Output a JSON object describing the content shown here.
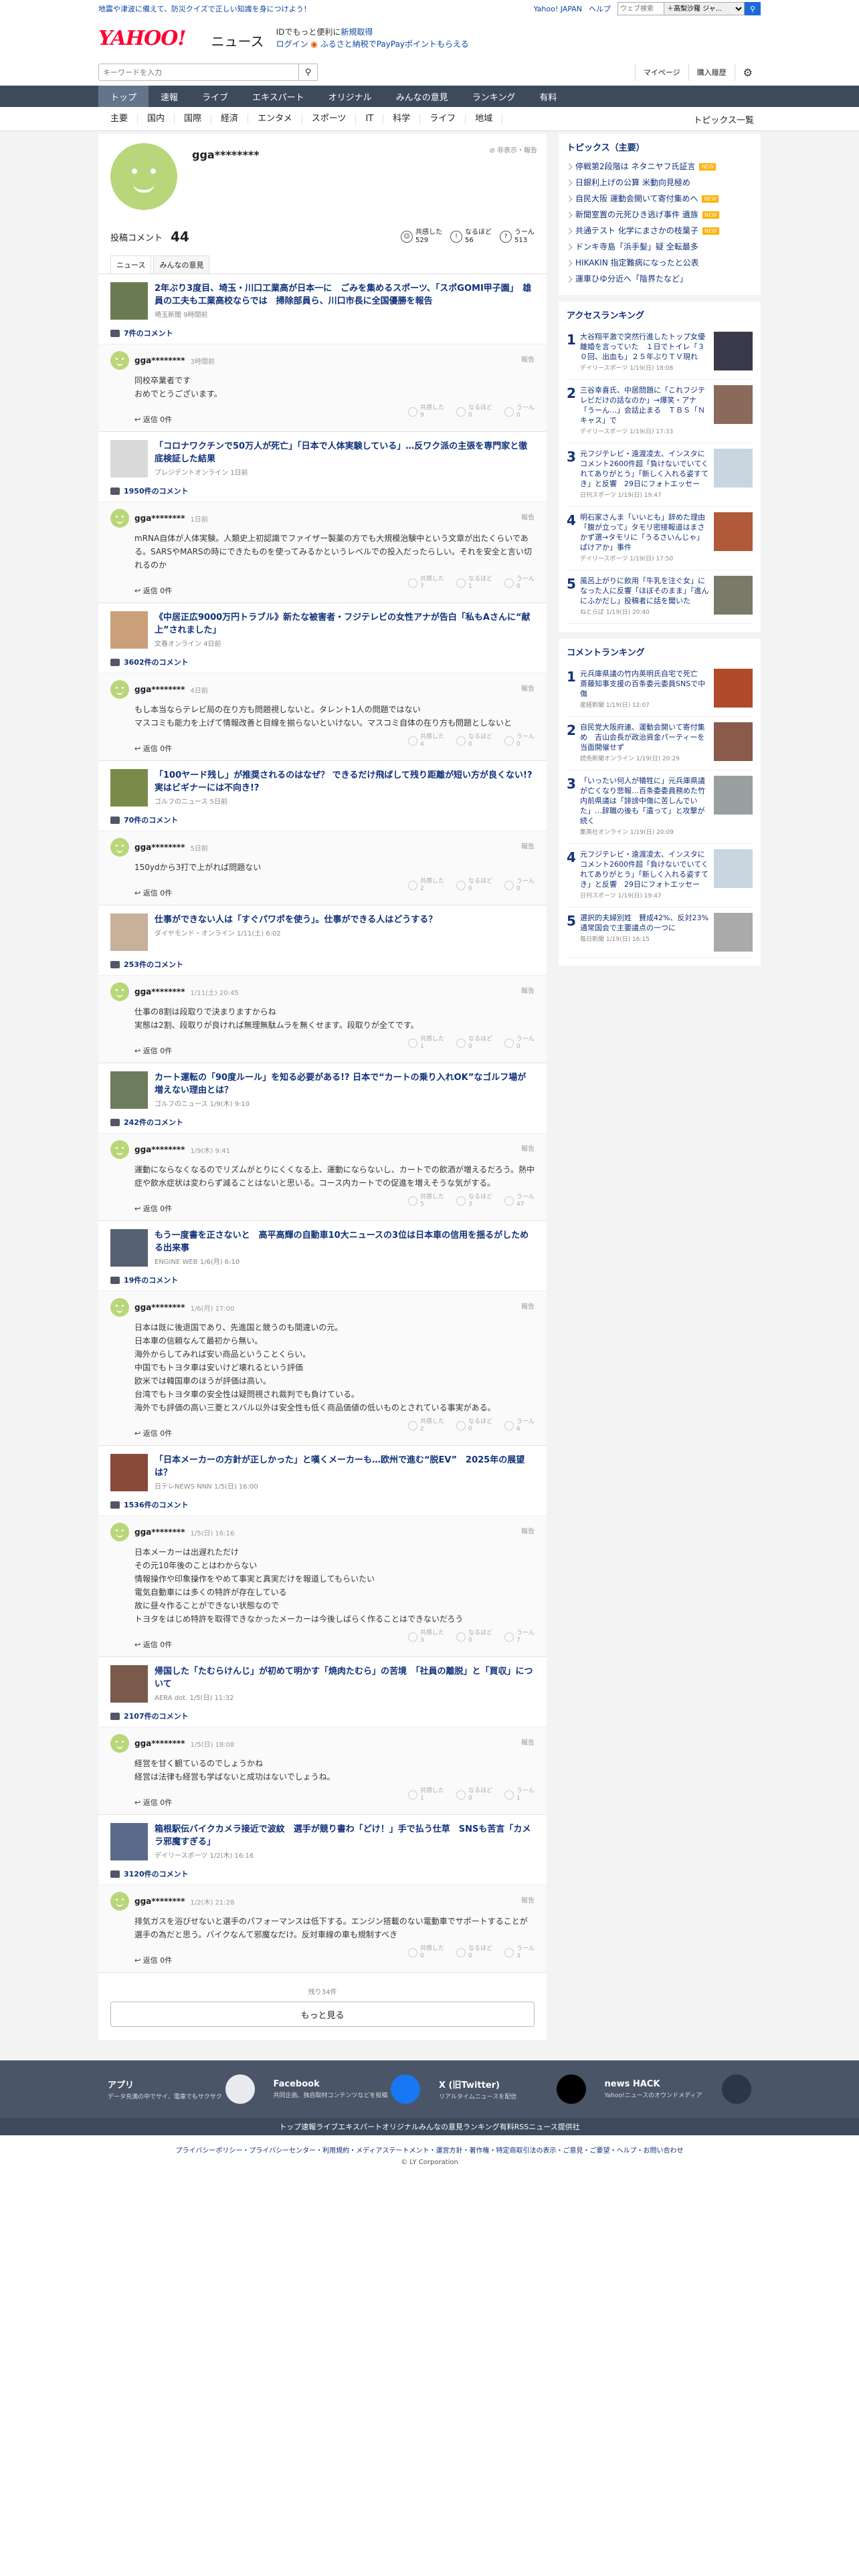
{
  "topstrip": {
    "promo": "地震や津波に備えて、防災クイズで正しい知識を身につけよう！",
    "yahoo": "Yahoo! JAPAN",
    "help": "ヘルプ",
    "search_placeholder": "ウェブ検索",
    "select": "＋高梨沙羅 ジャ..."
  },
  "header": {
    "logo": "YAHOO!",
    "logo_sub": "JAPAN",
    "service": "ニュース",
    "login_l1": "IDでもっと便利に",
    "login_l1_link": "新規取得",
    "login_link": "ログイン",
    "login_l2": "ふるさと納税でPayPayポイントもらえる"
  },
  "search": {
    "placeholder": "キーワードを入力",
    "mypage": "マイページ",
    "purchase": "購入履歴"
  },
  "tabs": [
    "トップ",
    "速報",
    "ライブ",
    "エキスパート",
    "オリジナル",
    "みんなの意見",
    "ランキング",
    "有料"
  ],
  "cats": [
    "主要",
    "国内",
    "国際",
    "経済",
    "エンタメ",
    "スポーツ",
    "IT",
    "科学",
    "ライフ",
    "地域"
  ],
  "cats_all": "トピックス一覧",
  "profile": {
    "name": "gga********",
    "report": "非表示・報告",
    "comments_label": "投稿コメント",
    "comments_count": "44",
    "rx1_label": "共感した",
    "rx1": "529",
    "rx2_label": "なるほど",
    "rx2": "56",
    "rx3_label": "うーん",
    "rx3": "513",
    "tab1": "ニュース",
    "tab2": "みんなの意見"
  },
  "entries": [
    {
      "title": "2年ぶり3度目、埼玉・川口工業高が日本一に　ごみを集めるスポーツ、「スポGOMI甲子園」　雄員の工夫も工業高校ならでは　掃除部員ら、川口市長に全国優勝を報告",
      "src": "埼玉新聞 9時間前",
      "count": "7件のコメント",
      "name": "gga********",
      "date": "3時間前",
      "body": [
        "同校卒業者です",
        "おめでとうございます。"
      ],
      "r1": "9",
      "r2": "0",
      "r3": "0"
    },
    {
      "title": "「コロナワクチンで50万人が死亡」「日本で人体実験している」…反ワク派の主張を専門家と徹底検証した結果",
      "src": "プレジデントオンライン 1日前",
      "count": "1950件のコメント",
      "name": "gga********",
      "date": "1日前",
      "body": [
        "mRNA自体が人体実験。人類史上初認識でファイザー製薬の方でも大規模治験中という文章が出たくらいである。SARSやMARSの時にできたものを使ってみるかというレベルでの投入だったらしい。それを安全と言い切れるのか"
      ],
      "r1": "7",
      "r2": "1",
      "r3": "0"
    },
    {
      "title": "《中居正広9000万円トラブル》新たな被害者・フジテレビの女性アナが告白「私もAさんに“献上”されました」",
      "src": "文春オンライン 4日前",
      "count": "3602件のコメント",
      "name": "gga********",
      "date": "4日前",
      "body": [
        "もし本当ならテレビ局の在り方も問題視しないと。タレント1人の問題ではない",
        "マスコミも能力を上げて情報改善と目線を揃らないといけない。マスコミ自体の在り方も問題としないと"
      ],
      "r1": "4",
      "r2": "0",
      "r3": "0"
    },
    {
      "title": "「100ヤード残し」が推奨されるのはなぜ？ できるだけ飛ばして残り距離が短い方が良くない!? 実はビギナーには不向き!?",
      "src": "ゴルフのニュース 5日前",
      "count": "70件のコメント",
      "name": "gga********",
      "date": "5日前",
      "body": [
        "150ydから3打で上がれば問題ない"
      ],
      "r1": "2",
      "r2": "0",
      "r3": "0"
    },
    {
      "title": "仕事ができない人は「すぐパワポを使う」。仕事ができる人はどうする？",
      "src": "ダイヤモンド・オンライン 1/11(土) 6:02",
      "count": "253件のコメント",
      "name": "gga********",
      "date": "1/11(土) 20:45",
      "body": [
        "仕事の8割は段取りで決まりますからね",
        "実態は2割、段取りが良ければ無理無駄ムラを無くせます。段取りが全てです。"
      ],
      "r1": "1",
      "r2": "0",
      "r3": "0"
    },
    {
      "title": "カート運転の「90度ルール」を知る必要がある!? 日本で“カートの乗り入れOK”なゴルフ場が増えない理由とは？",
      "src": "ゴルフのニュース 1/9(木) 9:10",
      "count": "242件のコメント",
      "name": "gga********",
      "date": "1/9(木) 9:41",
      "body": [
        "運動にならなくなるのでリズムがとりにくくなる上、運動にならないし、カートでの飲酒が増えるだろう。熱中症や飲水症状は変わらず減ることはないと思いる。コース内カートでの促進を増えそうな気がする。"
      ],
      "r1": "5",
      "r2": "3",
      "r3": "47"
    },
    {
      "title": "もう一度書を正さないと　高平高輝の自動車10大ニュースの3位は日本車の信用を揺るがしためる出来事",
      "src": "ENGINE WEB 1/6(月) 6:10",
      "count": "19件のコメント",
      "name": "gga********",
      "date": "1/6(月) 17:00",
      "body": [
        "日本は既に後退国であり、先進国と競うのも間違いの元。",
        "日本車の信頼なんて最初から無い。",
        "海外からしてみれば安い商品ということくらい。",
        "中国でもトヨタ車は安いけど壊れるという評価",
        "欧米では韓国車のほうが評価は高い。",
        "台湾でもトヨタ車の安全性は疑問視され裁判でも負けている。",
        "海外でも評価の高い三菱とスバル以外は安全性も低く商品価値の低いものとされている事実がある。"
      ],
      "r1": "2",
      "r2": "0",
      "r3": "6"
    },
    {
      "title": "「日本メーカーの方針が正しかった」と嘆くメーカーも…欧州で進む“脱EV”　2025年の展望は？",
      "src": "日テレNEWS NNN 1/5(日) 16:00",
      "count": "1536件のコメント",
      "name": "gga********",
      "date": "1/5(日) 16:16",
      "body": [
        "日本メーカーは出遅れただけ",
        "その元10年後のことはわからない",
        "情報操作や印象操作をやめて事実と真実だけを報道してもらいたい",
        "電気自動車には多くの特許が存在している",
        "故に昼々作ることができない状態なので",
        "トヨタをはじめ特許を取得できなかったメーカーは今後しばらく作ることはできないだろう"
      ],
      "r1": "3",
      "r2": "0",
      "r3": "7"
    },
    {
      "title": "帰国した「たむらけんじ」が初めて明かす「焼肉たむら」の苦境　「社員の離脱」と「買収」について",
      "src": "AERA dot. 1/5(日) 11:32",
      "count": "2107件のコメント",
      "name": "gga********",
      "date": "1/5(日) 18:08",
      "body": [
        "経営を甘く観ているのでしょうかね",
        "経営は法律も経営も学ばないと成功はないでしょうね。"
      ],
      "r1": "1",
      "r2": "0",
      "r3": "1"
    },
    {
      "title": "箱根駅伝バイクカメラ接近で波紋　選手が競り書わ「どけ！」手で払う仕草　SNSも苦言「カメラ邪魔すぎる」",
      "src": "デイリースポーツ 1/2(木) 16:16",
      "count": "3120件のコメント",
      "name": "gga********",
      "date": "1/2(木) 21:28",
      "body": [
        "排気ガスを浴びせないと選手のパフォーマンスは低下する。エンジン搭載のない電動車でサポートすることが選手の為だと思う。バイクなんて邪魔なだけ。反対車線の車も規制すべき"
      ],
      "r1": "0",
      "r2": "0",
      "r3": "3"
    }
  ],
  "rx_labels": {
    "a": "共感した",
    "b": "なるほど",
    "c": "うーん"
  },
  "reply_label": "返信 0件",
  "more": {
    "remaining": "残り34件",
    "button": "もっと見る"
  },
  "side": {
    "topics_title": "トピックス（主要）",
    "topics": [
      {
        "t": "停戦第2段階は ネタニヤフ氏証言",
        "new": "NEW"
      },
      {
        "t": "日銀利上げの公算 米動向見極め",
        "new": ""
      },
      {
        "t": "自民大阪 運動会開いて寄付集めへ",
        "new": "NEW"
      },
      {
        "t": "新聞室置の元死ひき逃げ事件 遺族",
        "new": "NEW"
      },
      {
        "t": "共通テスト 化学にまさかの枝葉子",
        "new": "NEW"
      },
      {
        "t": "ドンキ寺島「浜手髪」疑 全転最多",
        "new": ""
      },
      {
        "t": "HIKAKIN 指定難病になったと公表",
        "new": ""
      },
      {
        "t": "運車ひゆ分近へ「陰界たなど」",
        "new": ""
      }
    ],
    "access_title": "アクセスランキング",
    "access": [
      {
        "n": "1",
        "t": "大谷翔平激で突然行進したトップ女優　離婚を言っていた　１日でトイレ「３０回、出血も」２５年ぶりＴＶ現れ",
        "s": "デイリースポーツ 1/19(日) 18:08"
      },
      {
        "n": "2",
        "t": "三谷幸喜氏、中居問題に「これフジテレビだけの話なのか」→爆笑・アナ「うーん…」会話止まる　ＴＢＳ「Ｎキャス」で",
        "s": "デイリースポーツ 1/19(日) 17:33"
      },
      {
        "n": "3",
        "t": "元フジテレビ・遠渡凌太、インスタにコメント2600件超「負けないでいてくれてありがとう」「新しく入れる姿すてき」と反響　29日にフォトエッセー",
        "s": "日刊スポーツ 1/19(日) 19:47"
      },
      {
        "n": "4",
        "t": "明石家さんま「いいとも」辞めた理由「腹が立って」タモリ密接報道はまさかず選→タモリに「うるさいんじゃ」ぱけアか」事件",
        "s": "デイリースポーツ 1/19(日) 17:50"
      },
      {
        "n": "5",
        "t": "風呂上がりに飲用「牛乳を注ぐ女」になった人に反響「ほぼそのまま」「進んにふかだし」投稿者に話を聞いた",
        "s": "ねとらぼ 1/19(日) 20:40"
      }
    ],
    "comment_title": "コメントランキング",
    "comment": [
      {
        "n": "1",
        "t": "元兵庫県議の竹内英明氏自宅で死亡　斎藤知事支援の百条委元委員SNSで中傷",
        "s": "産経新聞 1/19(日) 12:07"
      },
      {
        "n": "2",
        "t": "自民党大阪府連、運動会開いて寄付集め　吉山会長が政治資金パーティーを当面開催せず",
        "s": "読売新聞オンライン 1/19(日) 20:29"
      },
      {
        "n": "3",
        "t": "「いったい何人が犠牲に」元兵庫県議が亡くなり悲報…百条委委員務めた竹内前県議は「誹謗中傷に苦しんでいた」…辞職の後も「遺って」と攻撃が続く",
        "s": "集英社オンライン 1/19(日) 20:09"
      },
      {
        "n": "4",
        "t": "元フジテレビ・遠渡凌太、インスタにコメント2600件超「負けないでいてくれてありがとう」「新しく入れる姿すてき」と反響　29日にフォトエッセー",
        "s": "日刊スポーツ 1/19(日) 19:47"
      },
      {
        "n": "5",
        "t": "選択的夫婦別姓　賛成42%、反対23%　通常国会で主要議点の一つに",
        "s": "毎日新聞 1/19(日) 16:15"
      }
    ]
  },
  "footer": {
    "apps": [
      {
        "t": "アプリ",
        "d": "データ充満の中でサイ、電車でもサクサク"
      },
      {
        "t": "Facebook",
        "d": "共同企画、独自取材コンテンツなどを投稿"
      },
      {
        "t": "X (旧Twitter)",
        "d": "リアルタイムニュースを配信"
      },
      {
        "t": "news HACK",
        "d": "Yahoo!ニュースのオウンドメディア"
      }
    ],
    "nav": [
      "トップ",
      "速報",
      "ライブ",
      "エキスパート",
      "オリジナル",
      "みんなの意見",
      "ランキング",
      "有料",
      "RSS",
      "ニュース提供社"
    ],
    "links": "プライバシーポリシー・プライバシーセンター・利用規約・メディアステートメント・運営方針・著作権・特定商取引法の表示・ご意見・ご要望・ヘルプ・お問い合わせ",
    "copy": "© LY Corporation"
  },
  "colors": {
    "tabbar": "#3d4a5c",
    "link": "#10317a",
    "brand": "#ff0033",
    "avatar": "#b9d67a"
  }
}
